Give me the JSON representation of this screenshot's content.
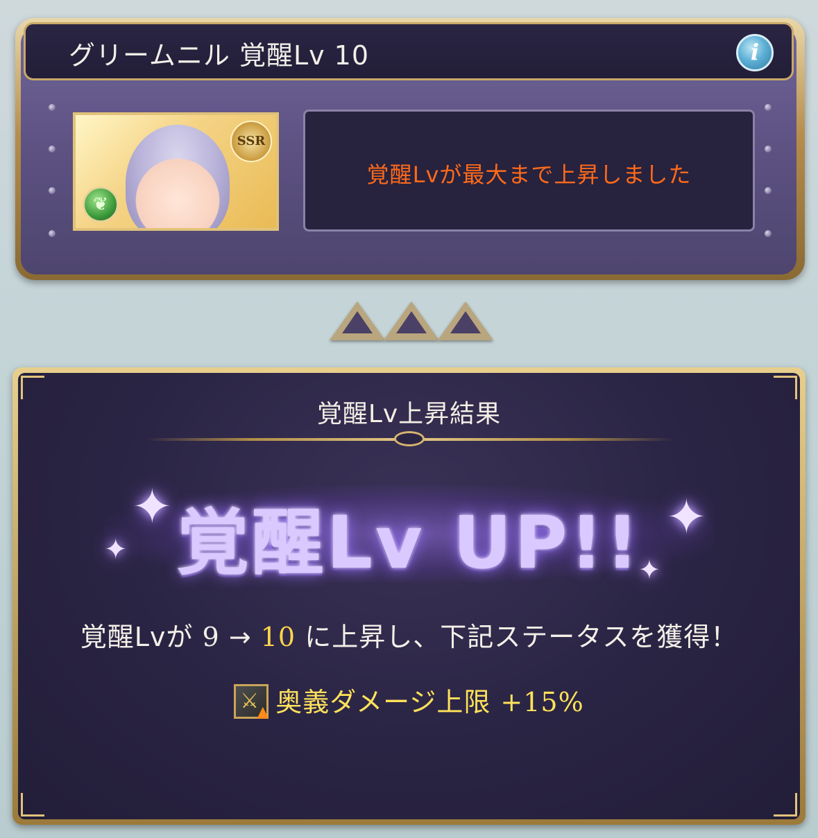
{
  "header": {
    "title": "グリームニル 覚醒Lv 10",
    "info_label": "i"
  },
  "character": {
    "rarity": "SSR",
    "element_icon": "wind-element-icon"
  },
  "message": "覚醒Lvが最大まで上昇しました",
  "result": {
    "title": "覚醒Lv上昇結果",
    "banner": "覚醒Lv UP!!",
    "line_prefix": "覚醒Lvが",
    "level_from": "9",
    "arrow": "→",
    "level_to": "10",
    "line_suffix": "に上昇し、下記ステータスを獲得！",
    "stat_name": "奥義ダメージ上限",
    "stat_value": "+15%"
  },
  "colors": {
    "message": "#ff6a1a",
    "highlight": "#ffd54a",
    "stat": "#ffe25a"
  }
}
